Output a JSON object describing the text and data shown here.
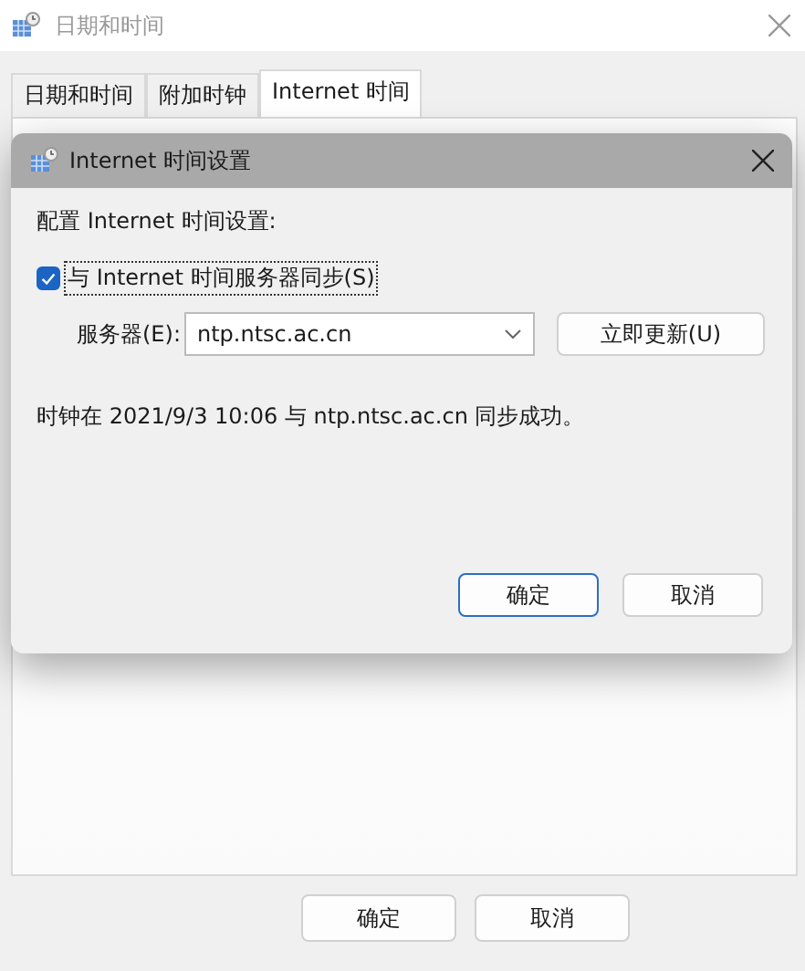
{
  "window": {
    "title": "日期和时间",
    "active": false
  },
  "tabs": [
    {
      "label": "日期和时间",
      "selected": false
    },
    {
      "label": "附加时钟",
      "selected": false
    },
    {
      "label": "Internet 时间",
      "selected": true
    }
  ],
  "dialog": {
    "title": "Internet 时间设置",
    "heading": "配置 Internet 时间设置:",
    "sync": {
      "label": "与 Internet 时间服务器同步(S)",
      "checked": true
    },
    "server": {
      "label": "服务器(E):",
      "value": "ntp.ntsc.ac.cn"
    },
    "update_button": "立即更新(U)",
    "status": "时钟在 2021/9/3 10:06 与 ntp.ntsc.ac.cn 同步成功。",
    "buttons": [
      {
        "label": "确定",
        "default": true
      },
      {
        "label": "取消",
        "default": false
      }
    ]
  },
  "buttons": [
    {
      "label": "确定",
      "default": false
    },
    {
      "label": "取消",
      "default": false
    }
  ]
}
